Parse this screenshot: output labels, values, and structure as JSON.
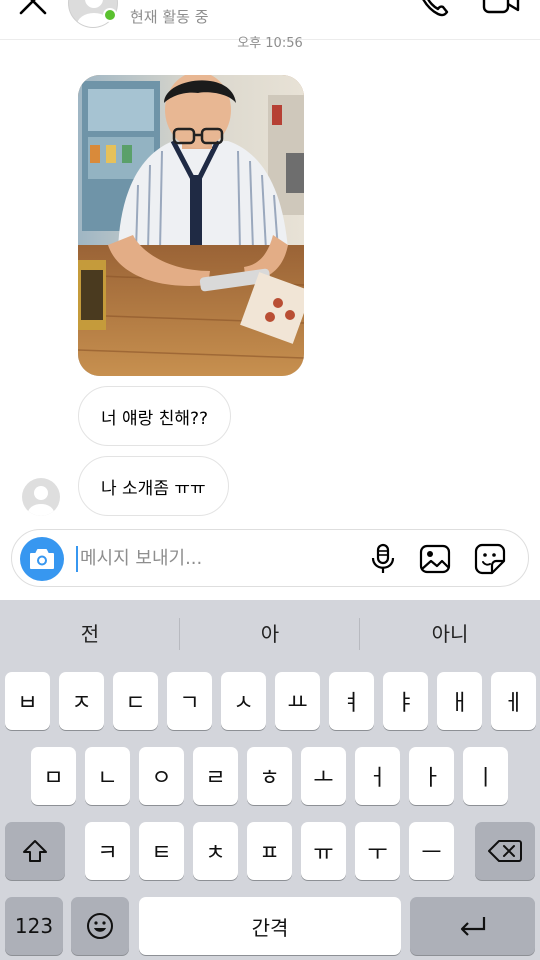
{
  "header": {
    "status": "현재 활동 중"
  },
  "chat": {
    "timestamp": "오후 10:56",
    "messages": [
      {
        "type": "photo",
        "description": ""
      },
      {
        "type": "text",
        "text": "너 얘랑 친해??"
      },
      {
        "type": "text",
        "text": "나 소개좀 ㅠㅠ"
      }
    ]
  },
  "composer": {
    "placeholder": "메시지 보내기..."
  },
  "keyboard": {
    "predictions": [
      "전",
      "아",
      "아니"
    ],
    "row1": [
      "ㅂ",
      "ㅈ",
      "ㄷ",
      "ㄱ",
      "ㅅ",
      "ㅛ",
      "ㅕ",
      "ㅑ",
      "ㅐ",
      "ㅔ"
    ],
    "row2": [
      "ㅁ",
      "ㄴ",
      "ㅇ",
      "ㄹ",
      "ㅎ",
      "ㅗ",
      "ㅓ",
      "ㅏ",
      "ㅣ"
    ],
    "row3": [
      "ㅋ",
      "ㅌ",
      "ㅊ",
      "ㅍ",
      "ㅠ",
      "ㅜ",
      "ㅡ"
    ],
    "numbers_key": "123",
    "space_key": "간격"
  },
  "colors": {
    "accent": "#3797f0",
    "online": "#5ac12f",
    "keyboard_bg": "#d3d5db"
  }
}
